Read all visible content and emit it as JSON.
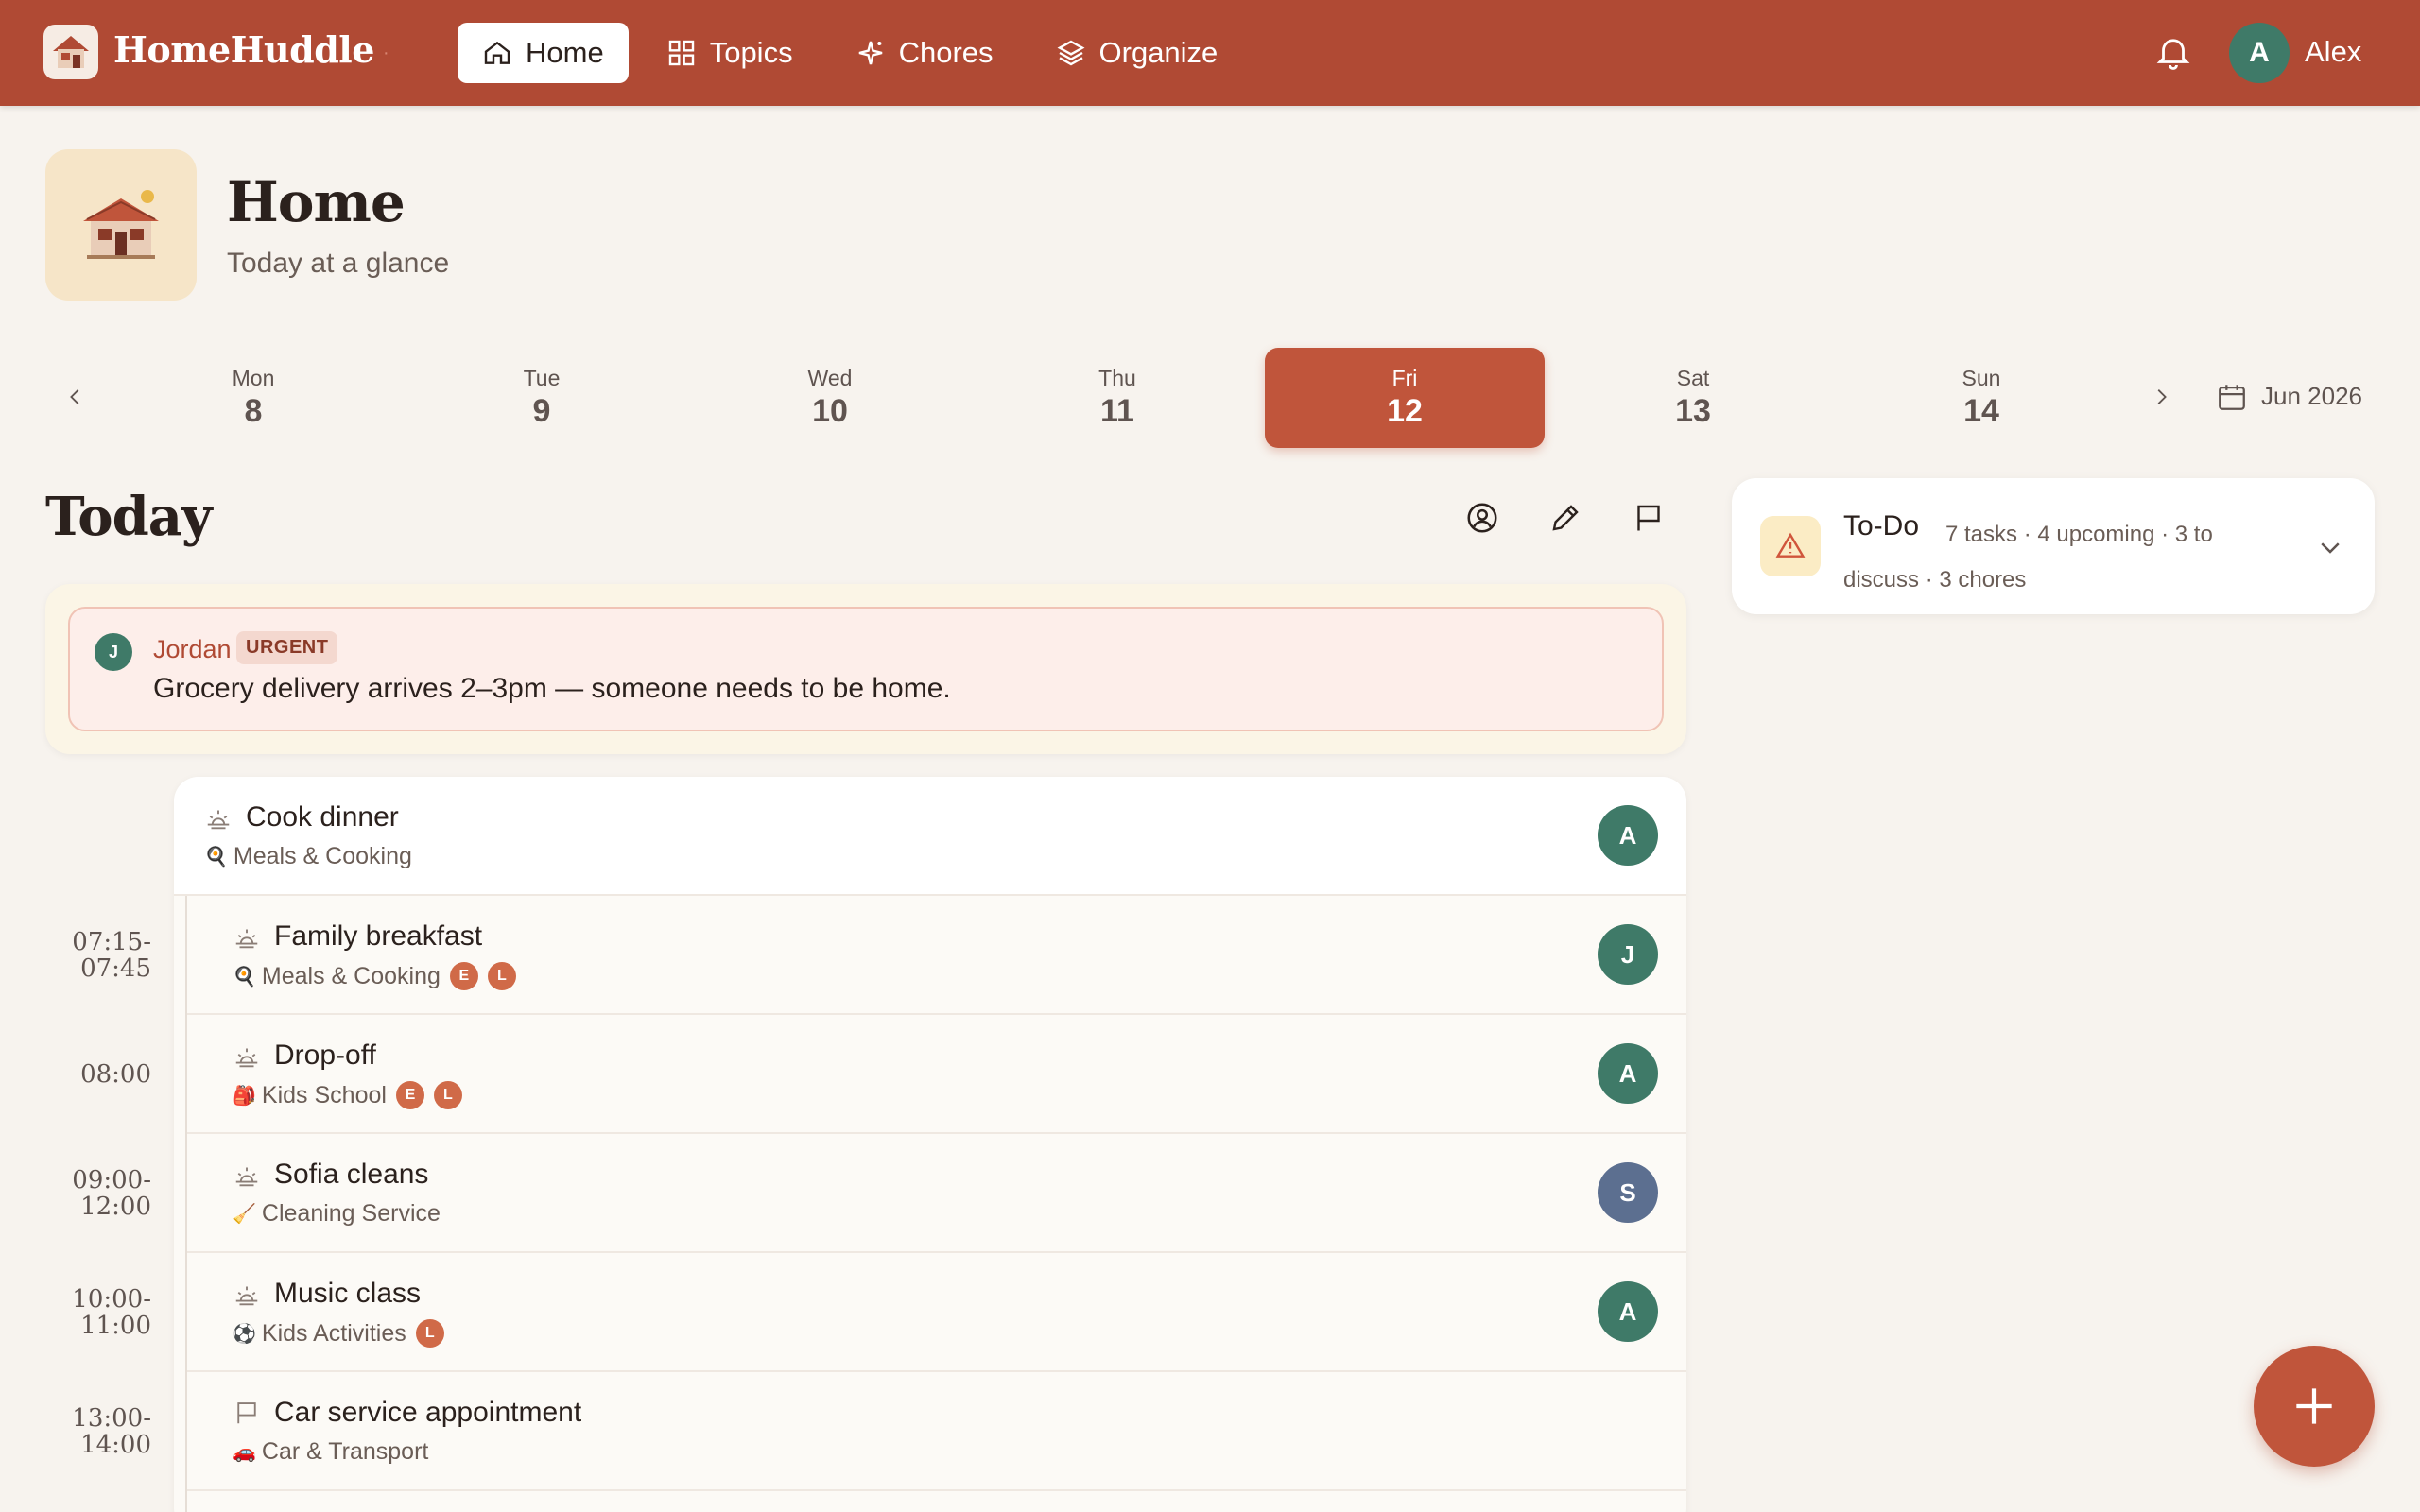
{
  "app": {
    "brand": "HomeHuddle",
    "user_initial": "A",
    "user_name": "Alex"
  },
  "nav": [
    {
      "label": "Home",
      "icon": "home-icon",
      "active": true
    },
    {
      "label": "Topics",
      "icon": "grid-icon"
    },
    {
      "label": "Chores",
      "icon": "sparkle-icon"
    },
    {
      "label": "Organize",
      "icon": "layers-icon"
    }
  ],
  "header": {
    "title": "Home",
    "subtitle": "Today at a glance"
  },
  "week": {
    "days": [
      {
        "name": "Mon",
        "num": "8"
      },
      {
        "name": "Tue",
        "num": "9"
      },
      {
        "name": "Wed",
        "num": "10"
      },
      {
        "name": "Thu",
        "num": "11"
      },
      {
        "name": "Fri",
        "num": "12",
        "active": true
      },
      {
        "name": "Sat",
        "num": "13"
      },
      {
        "name": "Sun",
        "num": "14"
      }
    ],
    "month": "Jun 2026"
  },
  "today": {
    "title": "Today",
    "urgent": {
      "initial": "J",
      "name": "Jordan",
      "badge": "URGENT",
      "text": "Grocery delivery arrives 2–3pm — someone needs to be home."
    }
  },
  "todo": {
    "title": "To-Do",
    "desc": "7 tasks · 4 upcoming · 3 to discuss · 3 chores"
  },
  "events": [
    {
      "time": "",
      "title": "Cook dinner",
      "topic": "Meals & Cooking",
      "topic_emoji": "🍳",
      "chips": [],
      "assignee": "A",
      "assignee_color": "#3f7a68",
      "kind": "sunrise-icon"
    },
    {
      "time": "07:15-\n07:45",
      "title": "Family breakfast",
      "topic": "Meals & Cooking",
      "topic_emoji": "🍳",
      "chips": [
        "E",
        "L"
      ],
      "assignee": "J",
      "assignee_color": "#3f7a68",
      "kind": "sunrise-icon"
    },
    {
      "time": "08:00",
      "title": "Drop-off",
      "topic": "Kids School",
      "topic_emoji": "🎒",
      "chips": [
        "E",
        "L"
      ],
      "assignee": "A",
      "assignee_color": "#3f7a68",
      "kind": "sunrise-icon"
    },
    {
      "time": "09:00-\n12:00",
      "title": "Sofia cleans",
      "topic": "Cleaning Service",
      "topic_emoji": "🧹",
      "chips": [],
      "assignee": "S",
      "assignee_color": "#5c6f90",
      "kind": "sunrise-icon"
    },
    {
      "time": "10:00-\n11:00",
      "title": "Music class",
      "topic": "Kids Activities",
      "topic_emoji": "⚽",
      "chips": [
        "L"
      ],
      "assignee": "A",
      "assignee_color": "#3f7a68",
      "kind": "sunrise-icon"
    },
    {
      "time": "13:00-\n14:00",
      "title": "Car service appointment",
      "topic": "Car & Transport",
      "topic_emoji": "🚗",
      "chips": [],
      "assignee": "",
      "assignee_color": "",
      "kind": "flag-icon"
    }
  ],
  "colors": {
    "accent": "#b04a34",
    "active_day": "#c0553b",
    "avatar_green": "#3f7a68",
    "avatar_slate": "#5c6f90",
    "chip": "#d06a48"
  }
}
